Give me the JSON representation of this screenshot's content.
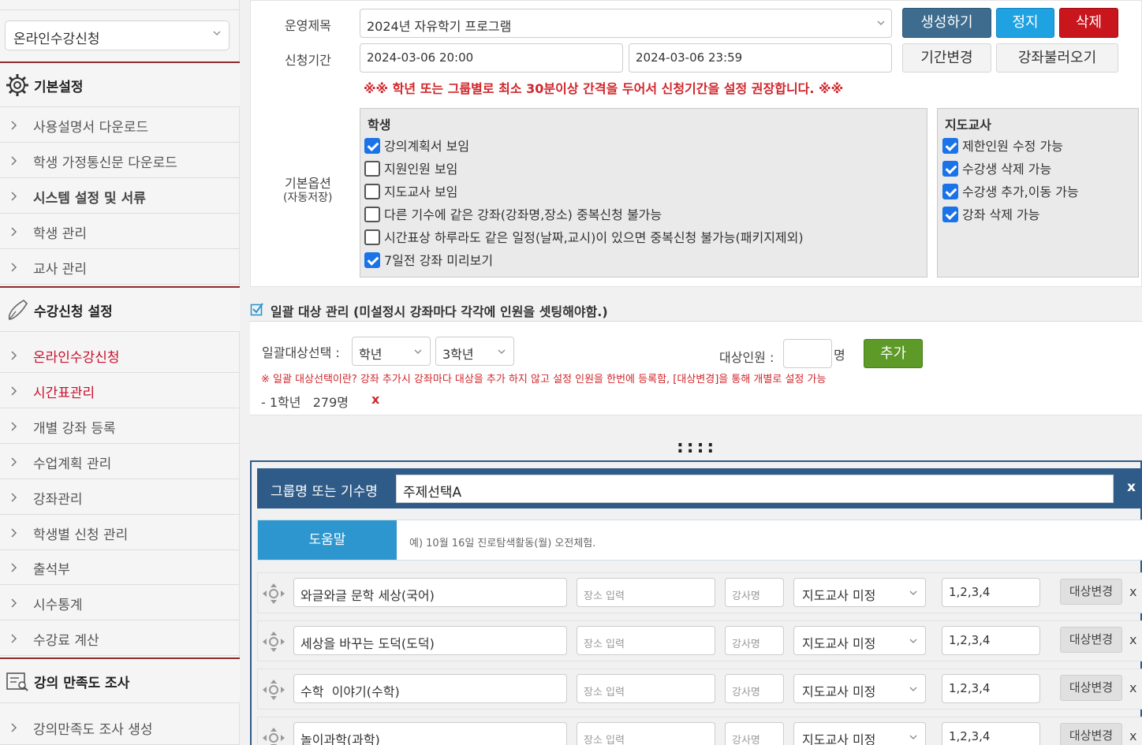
{
  "sidebar": {
    "select_value": "온라인수강신청",
    "sections": [
      {
        "title": "기본설정",
        "icon": "gear-icon"
      },
      {
        "title": "수강신청 설정",
        "icon": "pen-icon"
      },
      {
        "title": "강의 만족도 조사",
        "icon": "survey-icon"
      }
    ],
    "items": [
      {
        "label": "사용설명서 다운로드"
      },
      {
        "label": "학생 가정통신문 다운로드"
      },
      {
        "label": "시스템 설정 및 서류"
      },
      {
        "label": "학생 관리"
      },
      {
        "label": "교사 관리"
      },
      {
        "label": "온라인수강신청"
      },
      {
        "label": "시간표관리"
      },
      {
        "label": "개별 강좌 등록"
      },
      {
        "label": "수업계획 관리"
      },
      {
        "label": "강좌관리"
      },
      {
        "label": "학생별 신청 관리"
      },
      {
        "label": "출석부"
      },
      {
        "label": "시수통계"
      },
      {
        "label": "수강료 계산"
      },
      {
        "label": "강의만족도 조사 생성"
      }
    ]
  },
  "settings": {
    "program_label": "운영제목",
    "program_value": "2024년 자유학기 프로그램",
    "period_label": "신청기간",
    "period_start": "2024-03-06 20:00",
    "period_end": "2024-03-06 23:59",
    "create_btn": "생성하기",
    "stop_btn": "정지",
    "delete_btn": "삭제",
    "change_period_btn": "기간변경",
    "load_course_btn": "강좌불러오기",
    "warning": "※※ 학년 또는 그룹별로 최소 30분이상 간격을 두어서 신청기간을 설정 권장합니다. ※※",
    "options_label": "기본옵션",
    "options_sub": "(자동저장)"
  },
  "student_options": {
    "title": "학생",
    "items": [
      {
        "label": "강의계획서 보임",
        "checked": true
      },
      {
        "label": "지원인원 보임",
        "checked": false
      },
      {
        "label": "지도교사 보임",
        "checked": false
      },
      {
        "label": "다른 기수에 같은 강좌(강좌명,장소) 중복신청 불가능",
        "checked": false
      },
      {
        "label": "시간표상 하루라도 같은 일정(날짜,교시)이 있으면 중복신청 불가능(패키지제외)",
        "checked": false
      },
      {
        "label": "7일전 강좌 미리보기",
        "checked": true
      }
    ]
  },
  "teacher_options": {
    "title": "지도교사",
    "items": [
      {
        "label": "제한인원 수정 가능",
        "checked": true
      },
      {
        "label": "수강생 삭제 가능",
        "checked": true
      },
      {
        "label": "수강생 추가,이동 가능",
        "checked": true
      },
      {
        "label": "강좌 삭제 가능",
        "checked": true
      }
    ]
  },
  "bulk": {
    "title": "일괄 대상 관리 (미설정시 강좌마다 각각에 인원을 셋팅해야함.)",
    "select_label": "일괄대상선택 :",
    "type_value": "학년",
    "grade_value": "3학년",
    "count_label": "대상인원 :",
    "count_unit": "명",
    "add_btn": "추가",
    "note": "※ 일괄 대상선택이란? 강좌 추가시 강좌마다 대상을 추가 하지 않고 설정 인원을 한번에 등록함, [대상변경]을 통해 개별로 설정 가능",
    "entry": "- 1학년   279명",
    "entry_remove": "x"
  },
  "drag_handle": "::::",
  "group": {
    "label": "그룹명 또는 기수명",
    "value": "주제선택A",
    "close": "x",
    "help_btn": "도움말",
    "help_text": "예) 10월 16일 진로탐색활동(월) 오전체험."
  },
  "courses": [
    {
      "name": "와글와글 문학 세상(국어)",
      "place_placeholder": "장소 입력",
      "teacher_placeholder": "강사명",
      "advisor": "지도교사 미정",
      "periods": "1,2,3,4",
      "target_btn": "대상변경",
      "remove": "x"
    },
    {
      "name": "세상을 바꾸는 도덕(도덕)",
      "place_placeholder": "장소 입력",
      "teacher_placeholder": "강사명",
      "advisor": "지도교사 미정",
      "periods": "1,2,3,4",
      "target_btn": "대상변경",
      "remove": "x"
    },
    {
      "name": "수학  이야기(수학)",
      "place_placeholder": "장소 입력",
      "teacher_placeholder": "강사명",
      "advisor": "지도교사 미정",
      "periods": "1,2,3,4",
      "target_btn": "대상변경",
      "remove": "x"
    },
    {
      "name": "놀이과학(과학)",
      "place_placeholder": "장소 입력",
      "teacher_placeholder": "강사명",
      "advisor": "지도교사 미정",
      "periods": "1,2,3,4",
      "target_btn": "대상변경",
      "remove": "x"
    }
  ]
}
